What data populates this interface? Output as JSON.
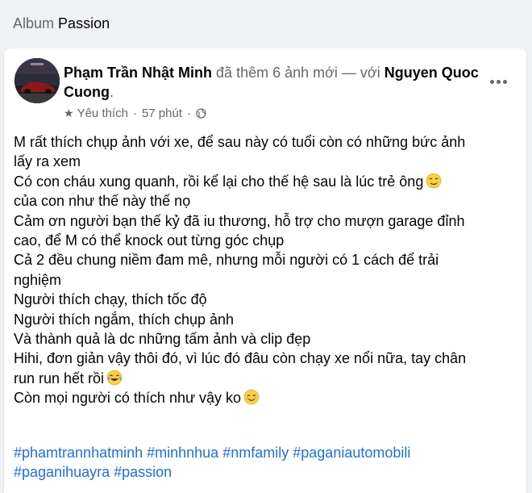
{
  "album": {
    "prefix": "Album",
    "name": "Passion"
  },
  "post": {
    "author": "Phạm Trần Nhật Minh",
    "action": "đã thêm 6 ảnh mới — với",
    "tagged": "Nguyen Quoc Cuong",
    "tagged_suffix": ".",
    "meta": {
      "feeling": "Yêu thích",
      "separator": "·",
      "time": "57 phút",
      "audience_icon": "globe-icon"
    },
    "lines": [
      {
        "text": "M rất thích chụp ảnh với xe, để sau này có tuổi còn có những bức ảnh"
      },
      {
        "text": "lấy ra xem"
      },
      {
        "text": "Có con cháu xung quanh, rồi kể lại cho thế hệ sau là lúc trẻ ông",
        "emoji": "smiling-face-with-tear-emoji"
      },
      {
        "text": "của con như thế này thế nọ"
      },
      {
        "text": "Cảm ơn người bạn thế kỷ đã iu thương, hỗ trợ cho mượn garage đỉnh"
      },
      {
        "text": "cao, để M có thể knock out từng góc chụp"
      },
      {
        "text": "Cả 2 đều chung niềm đam mê, nhưng mỗi người có 1 cách để trải"
      },
      {
        "text": "nghiệm"
      },
      {
        "text": "Người thích chạy, thích tốc độ"
      },
      {
        "text": "Người thích ngắm, thích chụp ảnh"
      },
      {
        "text": "Và thành quả là dc những tấm ảnh và clip đẹp"
      },
      {
        "text": "Hihi, đơn giản vậy thôi đó, vì lúc đó đâu còn chạy xe nổi nữa, tay chân"
      },
      {
        "text": "run run hết rồi",
        "emoji": "tears-of-joy-emoji"
      },
      {
        "text": "Còn mọi người có thích như vậy ko",
        "emoji": "smiling-face-emoji"
      }
    ],
    "hashtags": [
      "#phamtrannhatminh",
      "#minhnhua",
      "#nmfamily",
      "#paganiautomobili",
      "#paganihuayra",
      "#passion"
    ]
  },
  "colors": {
    "link": "#216fdb",
    "secondary_text": "#65676b",
    "background": "#f0f2f5"
  }
}
